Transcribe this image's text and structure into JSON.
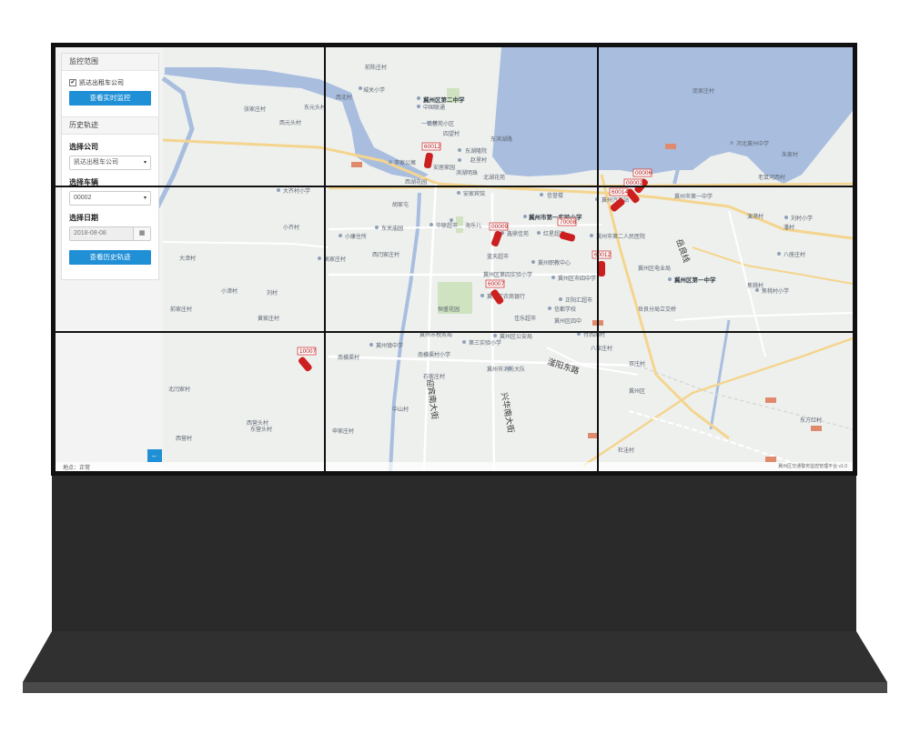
{
  "panel": {
    "monitor_title": "监控范围",
    "company_checkbox_label": "凯达出租车公司",
    "realtime_button": "查看实时监控",
    "history_title": "历史轨迹",
    "select_company_label": "选择公司",
    "select_company_value": "凯达出租车公司",
    "select_vehicle_label": "选择车辆",
    "select_vehicle_value": "00002",
    "select_date_label": "选择日期",
    "select_date_value": "2018-08-08",
    "history_button": "查看历史轨迹",
    "collapse_glyph": "←"
  },
  "status": {
    "left": "地点：正常",
    "right": "冀州区交通警务监控管理平台 v1.0"
  },
  "map": {
    "road_labels": [
      "迎宾南大街",
      "兴华南大街",
      "滏阳东路",
      "岳良线"
    ],
    "place_labels": [
      "前陈庄村",
      "西北村",
      "张家庄村",
      "东元头村",
      "西元头村",
      "城关小学",
      "冀州区第二中学",
      "中国联通",
      "一镇村",
      "学苑小区",
      "东湖隆院",
      "四望村",
      "东滨湖路",
      "赵里村",
      "李家公寓",
      "安居家园",
      "滨湖明珠",
      "北湖花苑",
      "安家宾馆",
      "西湖花园",
      "信誉楼",
      "冀州市第一实验小学",
      "华联超市",
      "海乐儿",
      "冀州市第二人民医院",
      "冀州职教中心",
      "蓝天超市",
      "鑫鼎佳苑",
      "红星超市",
      "冀州区第四实验小学",
      "冀州区市四中学",
      "正阳汇超市",
      "冀州区农商银行",
      "佳乐超市",
      "恒盛花园",
      "信都学校",
      "冀州区四中",
      "小康住所",
      "东关庙园",
      "西闫家庄村",
      "高家庄村",
      "大齐村小学",
      "胡家屯",
      "小齐村",
      "大漳村",
      "小漳村",
      "刘村",
      "前家庄村",
      "黄家庄村",
      "冀州区第一中学",
      "岳良分局立交桥",
      "冀州市第一中学",
      "冀州汽车站",
      "冀州区电业局",
      "八家庄村",
      "双庄村",
      "庞家庄村",
      "河北冀州中学",
      "朱家村",
      "老鼠河西村",
      "演港村",
      "刘村小学",
      "潘村",
      "焦桃村",
      "焦桃村小学",
      "冀州区公安局",
      "冀州市消防大队",
      "冀州镇中学",
      "冀州市税务局",
      "南横渠村",
      "南横渠村小学",
      "第三实验小学",
      "八座庄村",
      "付西阁村",
      "石家庄村",
      "中山村",
      "北闫家村",
      "西营头村",
      "东营头村",
      "冀州区",
      "西营村",
      "杜洼村",
      "申家庄村",
      "东方红村"
    ],
    "vehicles": [
      "60012",
      "00009",
      "70008",
      "60007",
      "00006",
      "00002",
      "60014",
      "60012",
      "10007"
    ]
  },
  "colors": {
    "accent": "#1f8fd6",
    "water": "#a9bedf",
    "road": "#f4d58e",
    "vehicle": "#cc1f1f"
  }
}
